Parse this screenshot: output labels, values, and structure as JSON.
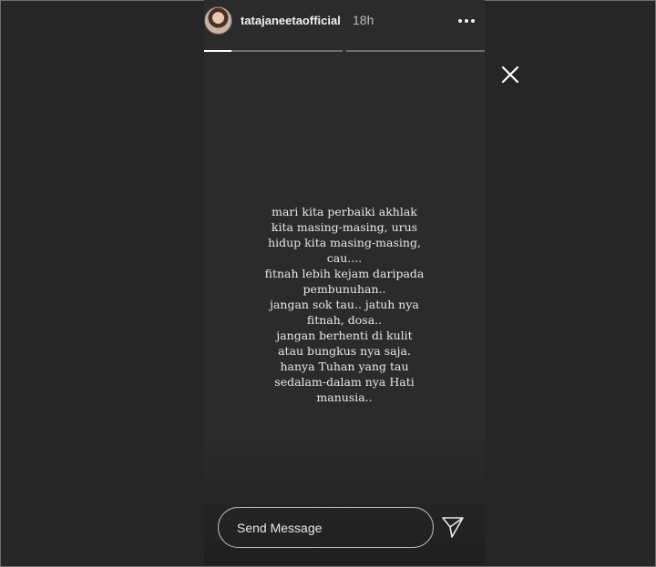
{
  "story": {
    "username": "tatajaneetaofficial",
    "time_ago": "18h",
    "progress": {
      "segments": 2,
      "active_index": 0,
      "active_fraction": 0.2
    },
    "caption_lines": [
      "mari kita perbaiki akhlak",
      "kita masing-masing, urus",
      "hidup kita masing-masing,",
      "cau....",
      "fitnah lebih kejam daripada",
      "pembunuhan..",
      "jangan sok tau.. jatuh nya",
      "fitnah, dosa..",
      "jangan berhenti di kulit",
      "atau bungkus nya saja.",
      "hanya Tuhan yang tau",
      "sedalam-dalam nya Hati",
      "manusia.."
    ]
  },
  "footer": {
    "message_placeholder": "Send Message"
  },
  "icons": {
    "more": "more-horizontal-icon",
    "close": "close-icon",
    "send": "paper-plane-icon"
  },
  "colors": {
    "background": "#262626",
    "story_background": "#2b2b2b",
    "text": "#e8e8e8",
    "progress_track": "#6f6f6f",
    "progress_fill": "#ffffff"
  }
}
